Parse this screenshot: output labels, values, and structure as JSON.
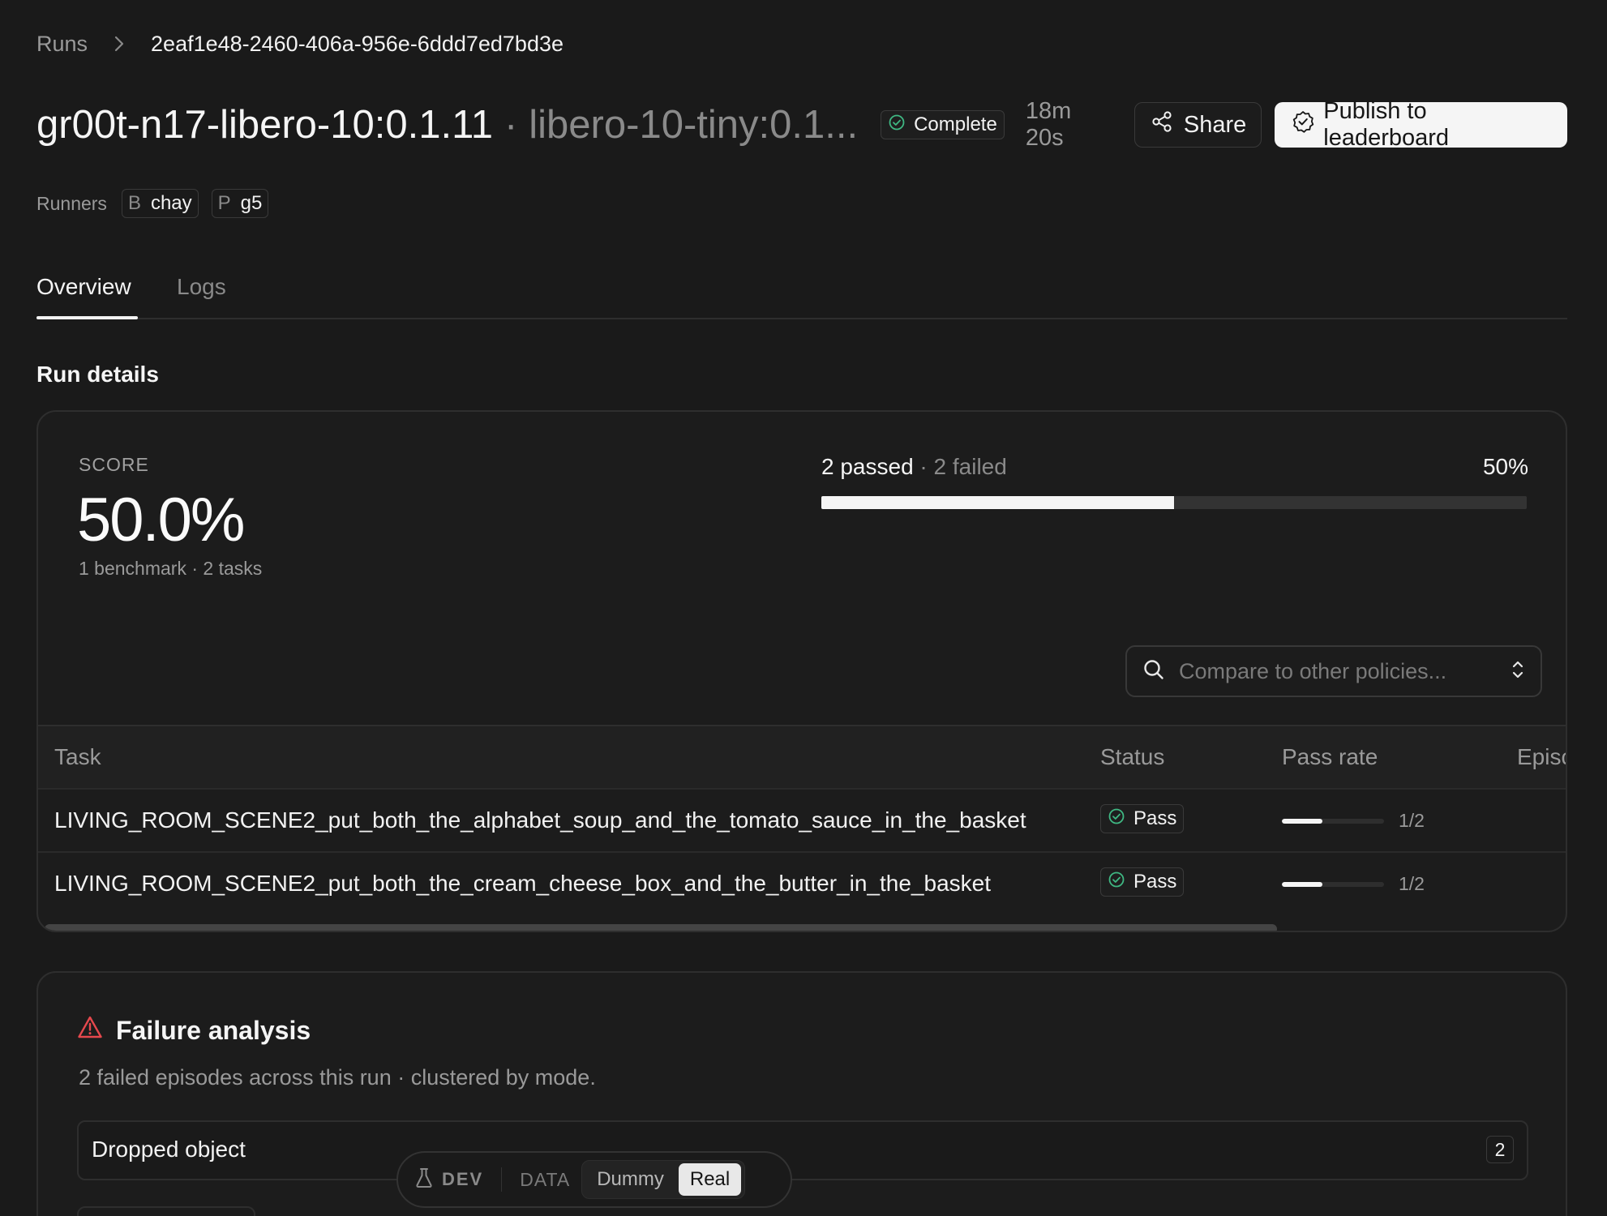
{
  "breadcrumb": {
    "root": "Runs",
    "current": "2eaf1e48-2460-406a-956e-6ddd7ed7bd3e"
  },
  "header": {
    "title": "gr00t-n17-libero-10:0.1.11",
    "separator": "·",
    "subtitle": "libero-10-tiny:0.1...",
    "status": "Complete",
    "duration": "18m 20s",
    "share_label": "Share",
    "publish_label": "Publish to leaderboard"
  },
  "runners": {
    "label": "Runners",
    "items": [
      {
        "prefix": "B",
        "name": "chay"
      },
      {
        "prefix": "P",
        "name": "g5"
      }
    ]
  },
  "tabs": [
    {
      "label": "Overview",
      "active": true
    },
    {
      "label": "Logs",
      "active": false
    }
  ],
  "run_details": {
    "section_title": "Run details",
    "score_label": "SCORE",
    "score_value": "50.0%",
    "score_meta": "1 benchmark · 2 tasks",
    "passed_text": "2 passed",
    "failed_text": " · 2 failed",
    "pass_percent_text": "50%",
    "pass_fraction": 0.5,
    "compare_placeholder": "Compare to other policies..."
  },
  "table": {
    "columns": [
      "Task",
      "Status",
      "Pass rate",
      "Episc"
    ],
    "rows": [
      {
        "task": "LIVING_ROOM_SCENE2_put_both_the_alphabet_soup_and_the_tomato_sauce_in_the_basket",
        "status": "Pass",
        "pass_rate": "1/2",
        "pass_fraction": 0.5
      },
      {
        "task": "LIVING_ROOM_SCENE2_put_both_the_cream_cheese_box_and_the_butter_in_the_basket",
        "status": "Pass",
        "pass_rate": "1/2",
        "pass_fraction": 0.5
      }
    ]
  },
  "failure_analysis": {
    "title": "Failure analysis",
    "description": "2 failed episodes across this run · clustered by mode.",
    "modes": [
      {
        "label": "Dropped object",
        "count": "2"
      }
    ]
  },
  "devbar": {
    "dev_label": "DEV",
    "data_label": "DATA",
    "options": [
      "Dummy",
      "Real"
    ],
    "selected": "Real"
  },
  "colors": {
    "background": "#1a1a1a",
    "success": "#3fb883",
    "warning": "#e5484d",
    "accent": "#f5f5f5"
  },
  "icons": {
    "breadcrumb_sep": "chevron-right-icon",
    "status": "check-circle-icon",
    "share": "share-icon",
    "publish": "badge-check-icon",
    "search": "search-icon",
    "compare_toggle": "chevron-up-down-icon",
    "failure": "warning-triangle-icon",
    "dev": "flask-icon"
  }
}
